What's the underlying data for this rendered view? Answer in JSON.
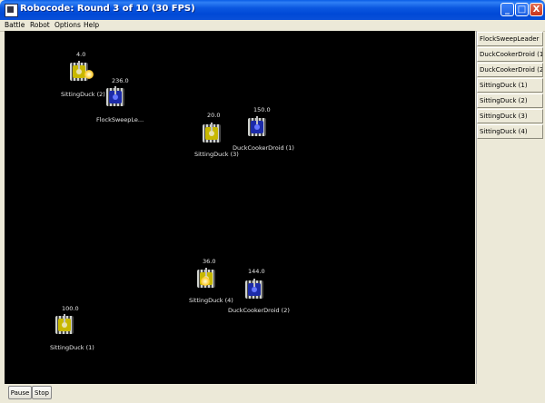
{
  "window": {
    "title": "Robocode: Round 3 of 10 (30 FPS)",
    "minimize": "_",
    "maximize": "□",
    "close": "X"
  },
  "menu": [
    "Battle",
    "Robot",
    "Options",
    "Help"
  ],
  "arena": {
    "robots": [
      {
        "name": "SittingDuck (2)",
        "energy": "4.0",
        "color": "yellow",
        "firing": true
      },
      {
        "name": "FlockSweepLe...",
        "energy": "236.0",
        "color": "blue",
        "firing": false
      },
      {
        "name": "SittingDuck (3)",
        "energy": "20.0",
        "color": "yellow",
        "firing": false
      },
      {
        "name": "DuckCookerDroid (1)",
        "energy": "150.0",
        "color": "blue",
        "firing": false
      },
      {
        "name": "SittingDuck (4)",
        "energy": "36.0",
        "color": "yellow",
        "firing": true
      },
      {
        "name": "DuckCookerDroid (2)",
        "energy": "144.0",
        "color": "blue",
        "firing": false
      },
      {
        "name": "SittingDuck (1)",
        "energy": "100.0",
        "color": "yellow",
        "firing": false
      }
    ]
  },
  "robot_list": [
    "FlockSweepLeader",
    "DuckCookerDroid (1)",
    "DuckCookerDroid (2)",
    "SittingDuck (1)",
    "SittingDuck (2)",
    "SittingDuck (3)",
    "SittingDuck (4)"
  ],
  "controls": {
    "pause": "Pause",
    "stop": "Stop"
  }
}
